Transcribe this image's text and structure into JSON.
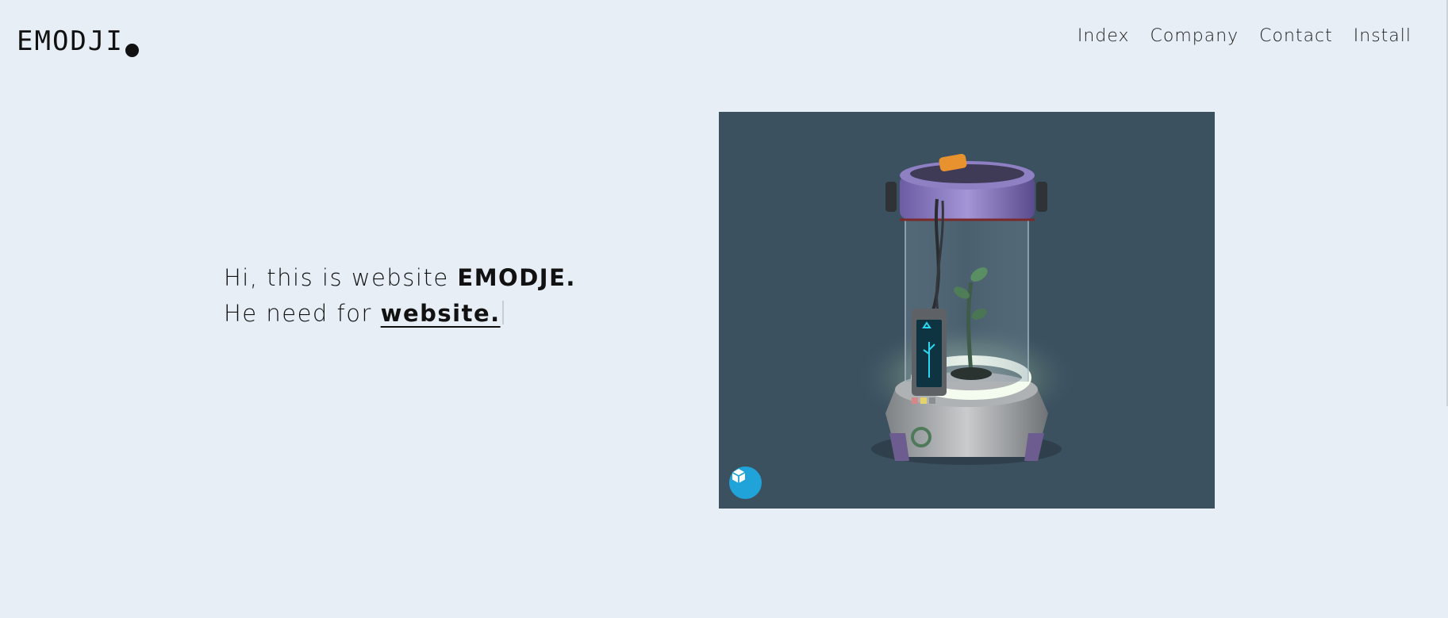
{
  "header": {
    "logo_text": "EMODJI",
    "nav": [
      {
        "label": "Index"
      },
      {
        "label": "Company"
      },
      {
        "label": "Contact"
      },
      {
        "label": "Install"
      }
    ]
  },
  "hero": {
    "line1_prefix": "Hi, this is website ",
    "line1_bold": "EMODJE.",
    "line2_prefix": "He need for ",
    "line2_link": "website."
  },
  "viewer": {
    "background": "#3c5160",
    "badge_icon": "sketchfab-cube-icon",
    "badge_color": "#1fa3d8"
  }
}
